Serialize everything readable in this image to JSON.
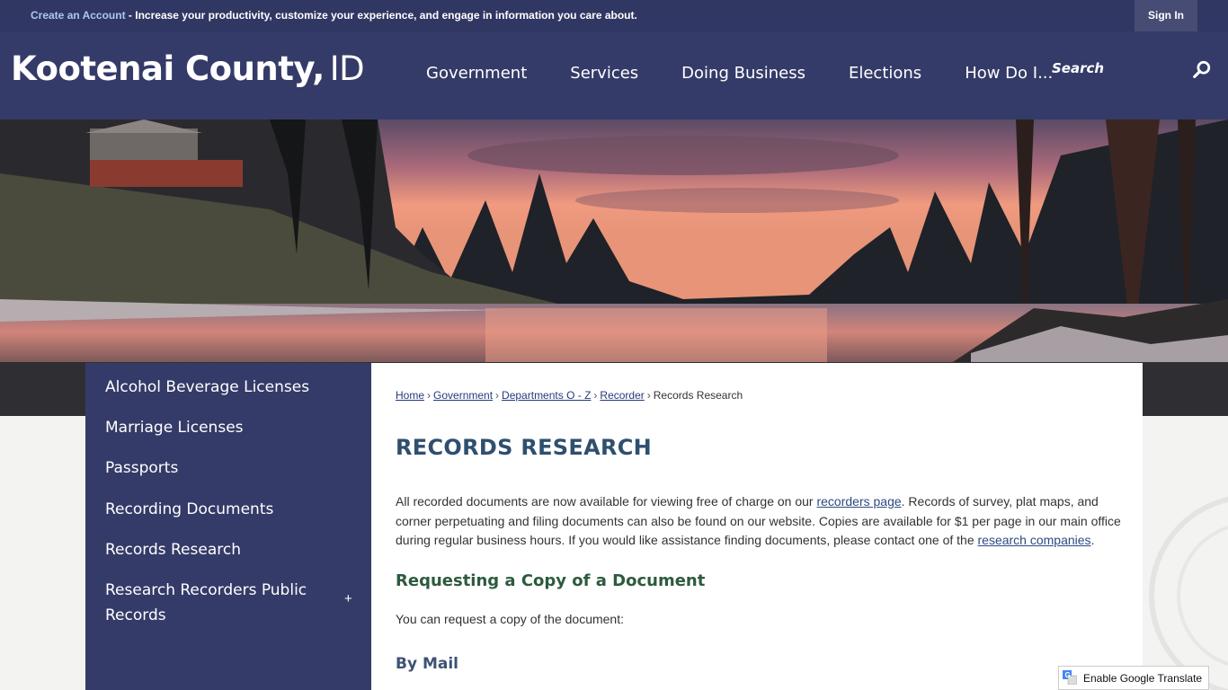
{
  "topbar": {
    "create_account": "Create an Account",
    "promo": " - Increase your productivity, customize your experience, and engage in information you care about.",
    "sign_in": "Sign In"
  },
  "header": {
    "logo_name": "Kootenai County,",
    "logo_state": "ID",
    "nav": [
      "Government",
      "Services",
      "Doing Business",
      "Elections",
      "How Do I..."
    ],
    "search_placeholder": "Search",
    "search_icon": "search-icon"
  },
  "sidebar": {
    "items": [
      {
        "label": "Alcohol Beverage Licenses"
      },
      {
        "label": "Marriage Licenses"
      },
      {
        "label": "Passports"
      },
      {
        "label": "Recording Documents"
      },
      {
        "label": "Records Research"
      },
      {
        "label": "Research Recorders Public Records"
      }
    ],
    "expand_glyph": "+"
  },
  "breadcrumb": {
    "items": [
      "Home",
      "Government",
      "Departments O - Z",
      "Recorder"
    ],
    "current": "Records Research",
    "separator": "›"
  },
  "main": {
    "title": "RECORDS RESEARCH",
    "para1_a": "All recorded documents are now available for viewing free of charge on our ",
    "para1_link1": "recorders page",
    "para1_b": ". Records of survey, plat maps, and corner perpetuating and filing documents can also be found on our website. Copies are available for $1 per page in our main office during regular business hours. If you would like assistance finding documents, please contact one of the ",
    "para1_link2": "research companies",
    "para1_c": ".",
    "h3": "Requesting a Copy of a Document",
    "para2": "You can request a copy of the document:",
    "h4": "By Mail"
  },
  "translate": {
    "label": "Enable Google Translate",
    "icon": "google-translate-icon"
  },
  "colors": {
    "navy": "#353b68",
    "title": "#2f4f6f",
    "heading_green": "#2d5a3e",
    "link": "#253a7c"
  }
}
